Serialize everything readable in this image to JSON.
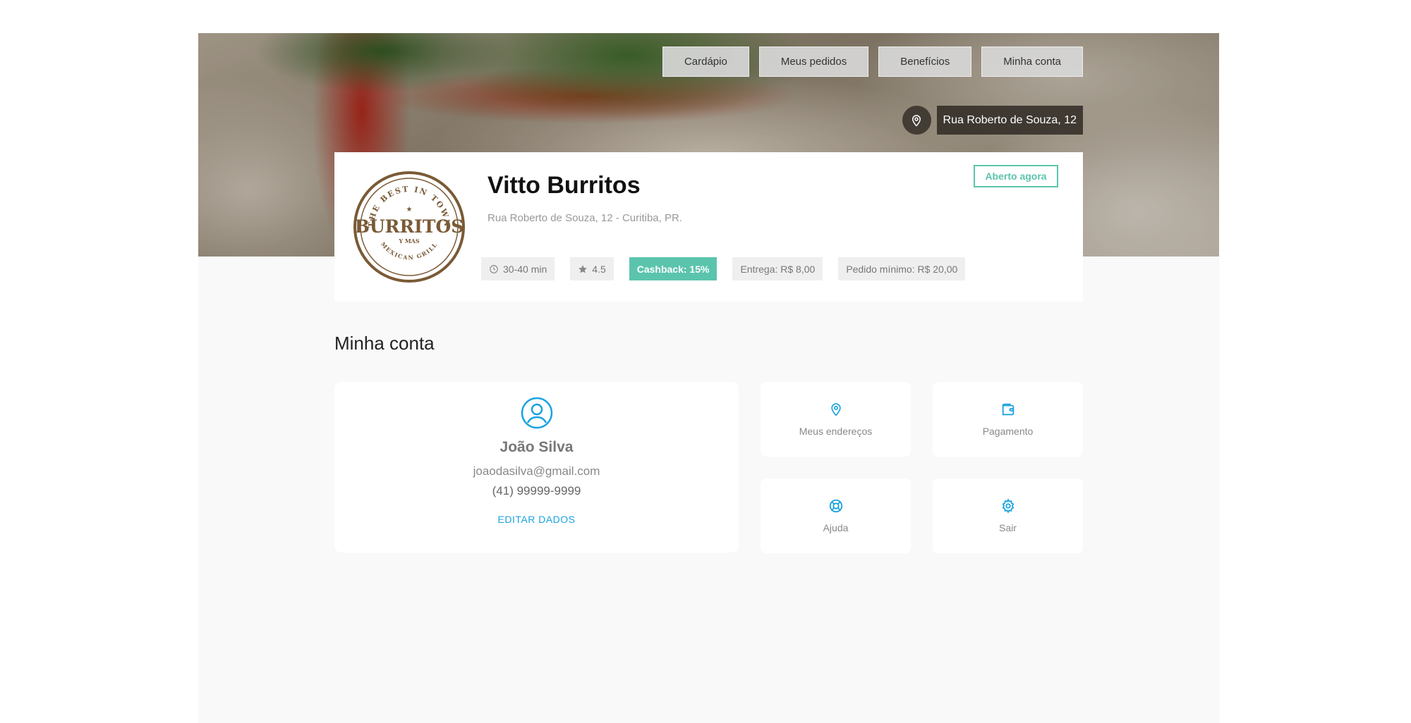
{
  "nav": {
    "items": [
      "Cardápio",
      "Meus pedidos",
      "Benefícios",
      "Minha conta"
    ]
  },
  "location": {
    "label": "Rua Roberto de Souza, 12",
    "icon": "map-pin-icon"
  },
  "store": {
    "name": "Vitto Burritos",
    "address": "Rua Roberto de Souza, 12 - Curitiba, PR.",
    "status": "Aberto agora",
    "logo": {
      "top_text": "THE BEST IN TOWN",
      "main_text": "BURRITOS",
      "sub_text": "Y MAS",
      "bottom_text": "MEXICAN GRILL"
    },
    "chips": {
      "time": "30-40 min",
      "rating": "4.5",
      "cashback": "Cashback: 15%",
      "delivery": "Entrega: R$ 8,00",
      "minimum": "Pedido mínimo: R$ 20,00"
    }
  },
  "account": {
    "title": "Minha conta",
    "user": {
      "name": "João Silva",
      "email": "joaodasilva@gmail.com",
      "phone": "(41) 99999-9999",
      "edit_label": "EDITAR DADOS"
    },
    "tiles": {
      "addresses": "Meus endereços",
      "payment": "Pagamento",
      "help": "Ajuda",
      "logout": "Sair"
    }
  },
  "colors": {
    "accent_green": "#5bc4ad",
    "accent_blue": "#1aa3e0",
    "logo_brown": "#7a5a36"
  }
}
